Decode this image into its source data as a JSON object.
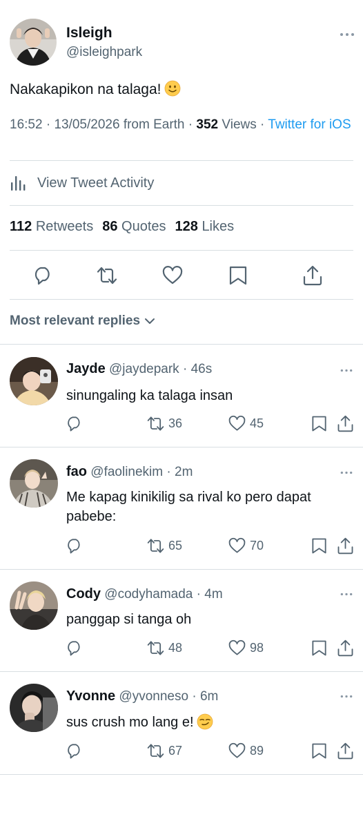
{
  "tweet": {
    "author_name": "Isleigh",
    "author_handle": "@isleighpark",
    "text": "Nakakapikon na talaga!",
    "emoji": "slightly-smiling-face",
    "time": "16:52",
    "date": "13/05/2026",
    "location_text": "from Earth",
    "views_count": "352",
    "views_label": "Views",
    "client": "Twitter for iOS",
    "activity_label": "View Tweet Activity",
    "retweets_count": "112",
    "retweets_label": "Retweets",
    "quotes_count": "86",
    "quotes_label": "Quotes",
    "likes_count": "128",
    "likes_label": "Likes"
  },
  "sort_label": "Most relevant replies",
  "replies": [
    {
      "name": "Jayde",
      "handle": "@jaydepark",
      "time": "46s",
      "text": "sinungaling ka talaga insan",
      "retweets": "36",
      "likes": "45"
    },
    {
      "name": "fao",
      "handle": "@faolinekim",
      "time": "2m",
      "text": "Me kapag kinikilig sa rival ko pero dapat pabebe:",
      "retweets": "65",
      "likes": "70"
    },
    {
      "name": "Cody",
      "handle": "@codyhamada",
      "time": "4m",
      "text": "panggap si tanga oh",
      "retweets": "48",
      "likes": "98"
    },
    {
      "name": "Yvonne",
      "handle": "@yvonneso",
      "time": "6m",
      "text": "sus crush mo lang e!",
      "emoji": "smirking-face",
      "retweets": "67",
      "likes": "89"
    }
  ],
  "colors": {
    "text": "#0f1419",
    "muted": "#536471",
    "link": "#1d9bf0",
    "divider": "#d8dee2"
  }
}
